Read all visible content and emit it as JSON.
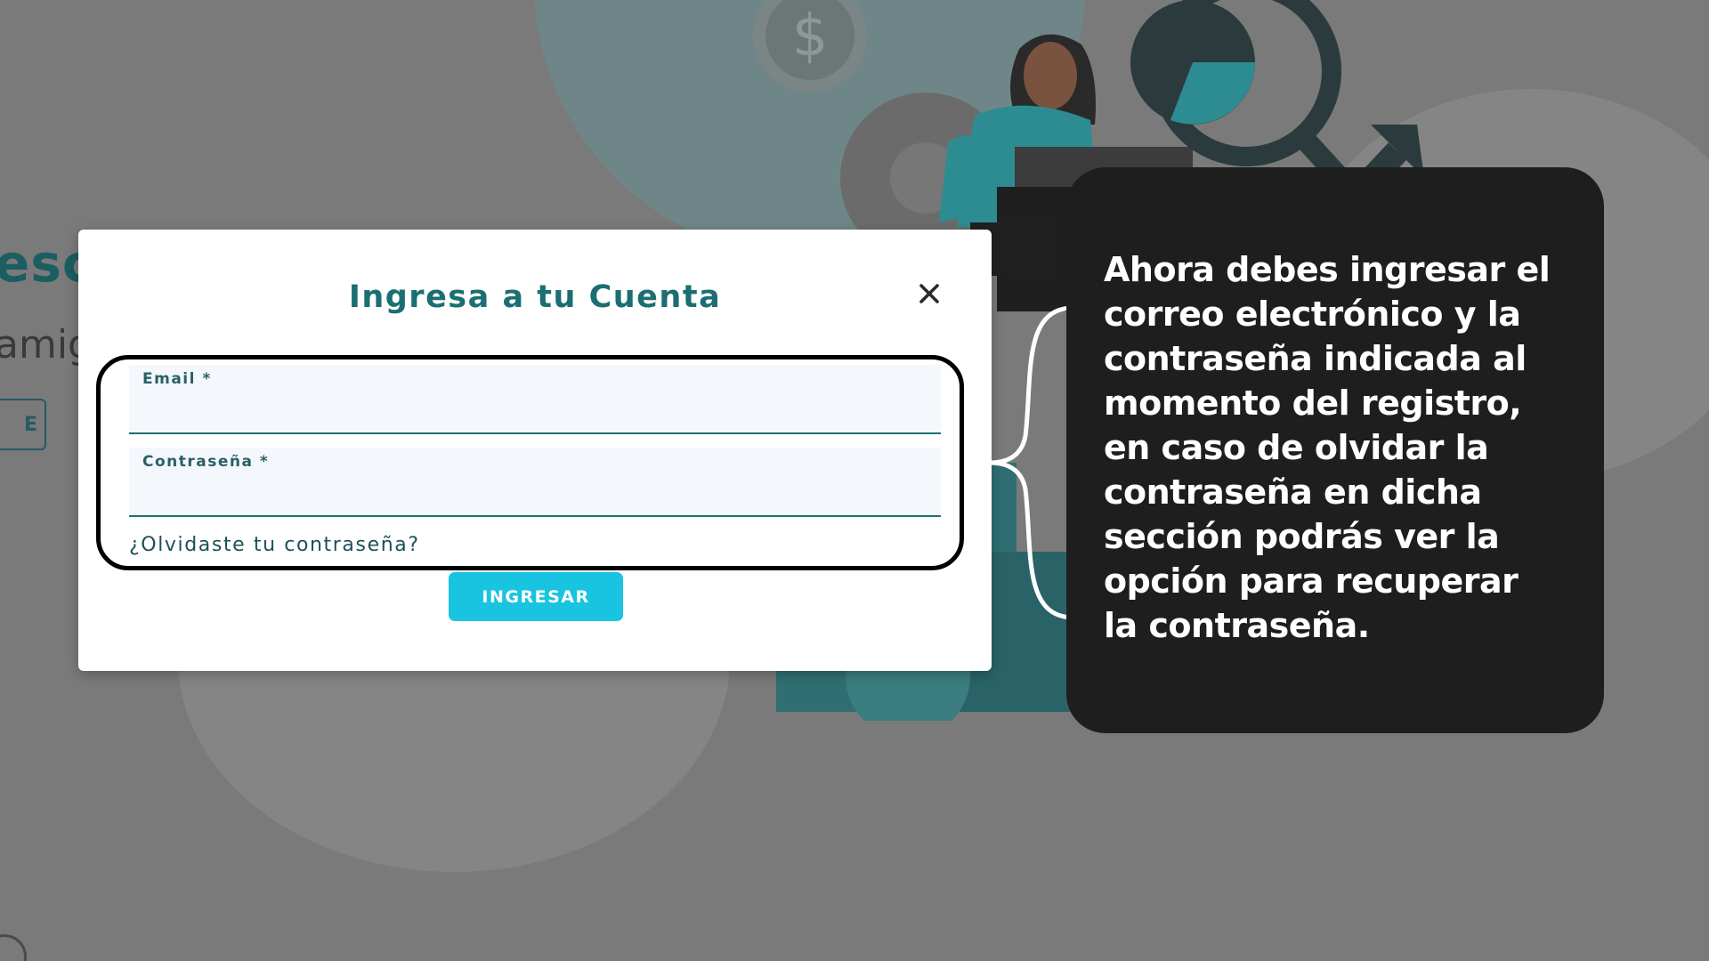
{
  "background_page": {
    "heading_fragment": "esc",
    "subtitle_fragment": "amig",
    "button_fragment": "E"
  },
  "modal": {
    "title": "Ingresa a tu Cuenta",
    "email_label": "Email *",
    "email_value": "",
    "password_label": "Contraseña *",
    "password_value": "",
    "forgot_password": "¿Olvidaste tu contraseña?",
    "submit_label": "INGRESAR"
  },
  "annotation": {
    "text": "Ahora debes ingresar el correo electrónico y la contraseña indicada al momento del registro, en caso de olvidar la contraseña en dicha sección podrás ver la opción para recuperar la contraseña."
  },
  "colors": {
    "overlay": "#7a7a7a",
    "brand_teal": "#1b6e72",
    "accent_cyan": "#18c4e0",
    "annotation_bg": "#1e1e1e"
  },
  "icons": {
    "close": "close-icon",
    "brace": "curly-brace-icon"
  }
}
